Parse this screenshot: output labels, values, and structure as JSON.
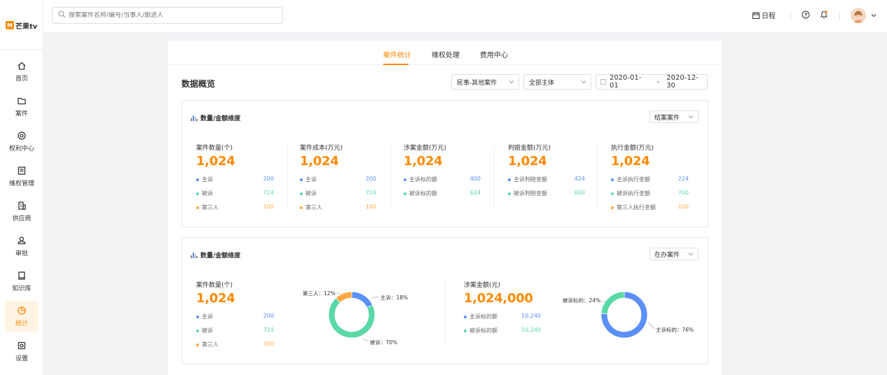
{
  "app": {
    "logo_text": "芒果tv"
  },
  "sidebar": {
    "items": [
      {
        "label": "首页",
        "icon": "home-icon"
      },
      {
        "label": "案件",
        "icon": "folder-icon"
      },
      {
        "label": "权利中心",
        "icon": "rights-icon"
      },
      {
        "label": "维权管理",
        "icon": "manage-icon"
      },
      {
        "label": "供应商",
        "icon": "building-icon"
      },
      {
        "label": "审批",
        "icon": "stamp-icon"
      },
      {
        "label": "知识库",
        "icon": "book-icon"
      },
      {
        "label": "统计",
        "icon": "pie-icon",
        "active": true
      },
      {
        "label": "设置",
        "icon": "settings-icon"
      }
    ]
  },
  "topbar": {
    "search_placeholder": "搜索案件名称/编号/当事人/跟进人",
    "schedule_label": "日程"
  },
  "tabs": [
    {
      "label": "案件统计",
      "active": true
    },
    {
      "label": "维权处理"
    },
    {
      "label": "费用中心"
    }
  ],
  "overview": {
    "title": "数据概览",
    "filter_case_type": "民事-其他案件",
    "filter_entity": "全部主体",
    "date_start": "2020-01-01",
    "date_sep": "-",
    "date_end": "2020-12-30"
  },
  "panel1": {
    "title": "数量/金额维度",
    "filter": "结案案件",
    "stats": [
      {
        "title": "案件数量(个)",
        "value": "1,024",
        "rows": [
          {
            "label": "主诉",
            "value": "200",
            "color": "blue"
          },
          {
            "label": "被诉",
            "value": "724",
            "color": "green"
          },
          {
            "label": "第三人",
            "value": "100",
            "color": "orange"
          }
        ]
      },
      {
        "title": "案件成本(万元)",
        "value": "1,024",
        "rows": [
          {
            "label": "主诉",
            "value": "200",
            "color": "blue"
          },
          {
            "label": "被诉",
            "value": "724",
            "color": "green"
          },
          {
            "label": "第三人",
            "value": "100",
            "color": "orange"
          }
        ]
      },
      {
        "title": "涉案金额(万元)",
        "value": "1,024",
        "rows": [
          {
            "label": "主诉标的额",
            "value": "400",
            "color": "blue"
          },
          {
            "label": "被诉标的额",
            "value": "624",
            "color": "green"
          }
        ]
      },
      {
        "title": "判赔金额(万元)",
        "value": "1,024",
        "rows": [
          {
            "label": "主诉判赔金额",
            "value": "424",
            "color": "blue"
          },
          {
            "label": "被诉判赔金额",
            "value": "600",
            "color": "green"
          }
        ]
      },
      {
        "title": "执行金额(万元)",
        "value": "1,024",
        "rows": [
          {
            "label": "主诉执行金额",
            "value": "224",
            "color": "blue"
          },
          {
            "label": "被诉执行金额",
            "value": "700",
            "color": "green"
          },
          {
            "label": "第三人执行金额",
            "value": "100",
            "color": "orange"
          }
        ]
      }
    ]
  },
  "panel2": {
    "title": "数量/金额维度",
    "filter": "在办案件",
    "stats": [
      {
        "title": "案件数量(个)",
        "value": "1,024",
        "rows": [
          {
            "label": "主诉",
            "value": "200",
            "color": "blue"
          },
          {
            "label": "被诉",
            "value": "724",
            "color": "green"
          },
          {
            "label": "第三人",
            "value": "100",
            "color": "orange"
          }
        ]
      },
      {
        "title": "涉案金额(元)",
        "value": "1,024,000",
        "rows": [
          {
            "label": "主诉标的额",
            "value": "10,240",
            "color": "blue"
          },
          {
            "label": "被诉标的额",
            "value": "10,240",
            "color": "green"
          }
        ]
      }
    ]
  },
  "chart_data": [
    {
      "type": "pie",
      "labels": [
        "主诉",
        "被诉",
        "第三人"
      ],
      "values": [
        18,
        70,
        12
      ],
      "label_texts": [
        "主诉：18%",
        "被诉：70%",
        "第三人：12%"
      ],
      "colors": [
        "#5b8ff9",
        "#5ad8a6",
        "#ffa940"
      ]
    },
    {
      "type": "pie",
      "labels": [
        "主诉标的",
        "被诉标的"
      ],
      "values": [
        76,
        24
      ],
      "label_texts": [
        "主诉标的：76%",
        "被诉标的：24%"
      ],
      "colors": [
        "#5b8ff9",
        "#5ad8a6"
      ]
    }
  ],
  "colors": {
    "accent": "#ff8a00",
    "blue": "#5b8ff9",
    "green": "#5ad8a6",
    "orange": "#ffa940"
  }
}
